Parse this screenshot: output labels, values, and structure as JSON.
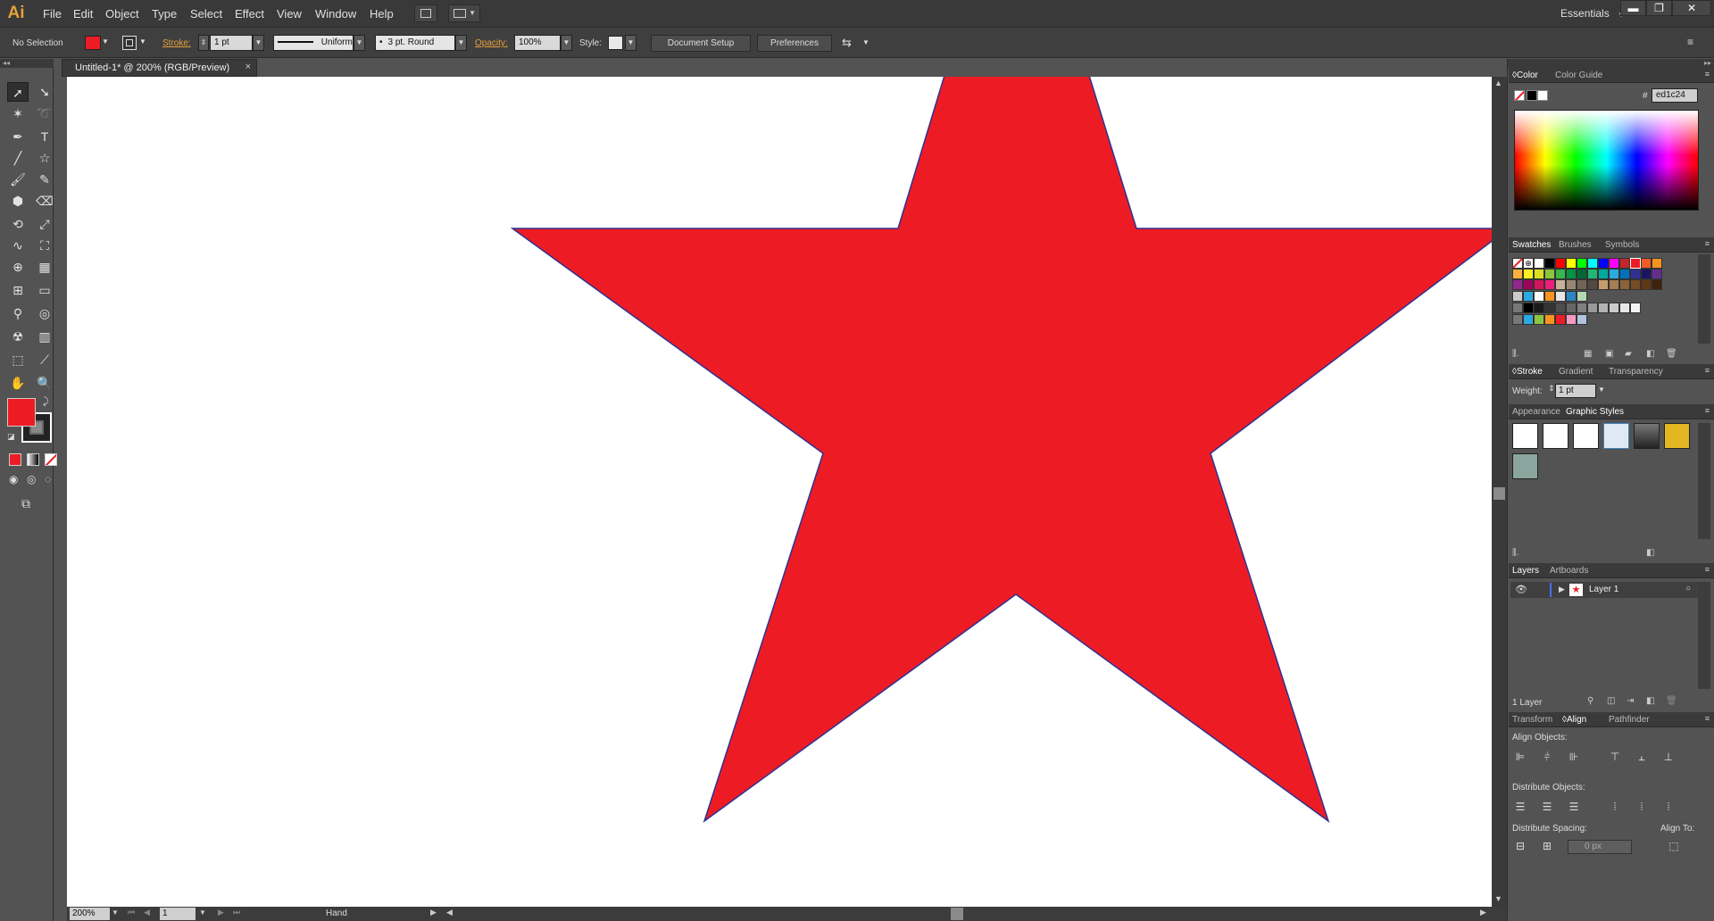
{
  "app": {
    "logo": "Ai"
  },
  "menu": [
    "File",
    "Edit",
    "Object",
    "Type",
    "Select",
    "Effect",
    "View",
    "Window",
    "Help"
  ],
  "workspace": "Essentials",
  "control_bar": {
    "selection": "No Selection",
    "stroke_label": "Stroke:",
    "stroke_weight": "1 pt",
    "stroke_profile": "Uniform",
    "brush": "3 pt. Round",
    "opacity_label": "Opacity:",
    "opacity": "100%",
    "style_label": "Style:",
    "document_setup": "Document Setup",
    "preferences": "Preferences"
  },
  "document": {
    "tab_title": "Untitled-1* @ 200% (RGB/Preview)",
    "close_glyph": "×"
  },
  "colors": {
    "star_fill": "#ed1c24",
    "star_stroke": "#2e3192"
  },
  "status": {
    "zoom": "200%",
    "artboard": "1",
    "tool": "Hand"
  },
  "color_panel": {
    "tabs": [
      "Color",
      "Color Guide"
    ],
    "hex_label": "#",
    "hex": "ed1c24"
  },
  "swatches_panel": {
    "tabs": [
      "Swatches",
      "Brushes",
      "Symbols"
    ]
  },
  "stroke_panel": {
    "tabs": [
      "Stroke",
      "Gradient",
      "Transparency"
    ],
    "weight_label": "Weight:",
    "weight": "1 pt"
  },
  "appearance_panel": {
    "tabs": [
      "Appearance",
      "Graphic Styles"
    ]
  },
  "layers_panel": {
    "tabs": [
      "Layers",
      "Artboards"
    ],
    "layer_name": "Layer 1",
    "count": "1 Layer"
  },
  "align_panel": {
    "tabs": [
      "Transform",
      "Align",
      "Pathfinder"
    ],
    "align_objects": "Align Objects:",
    "distribute_objects": "Distribute Objects:",
    "distribute_spacing": "Distribute Spacing:",
    "align_to": "Align To:",
    "spacing_value": "0 px"
  }
}
